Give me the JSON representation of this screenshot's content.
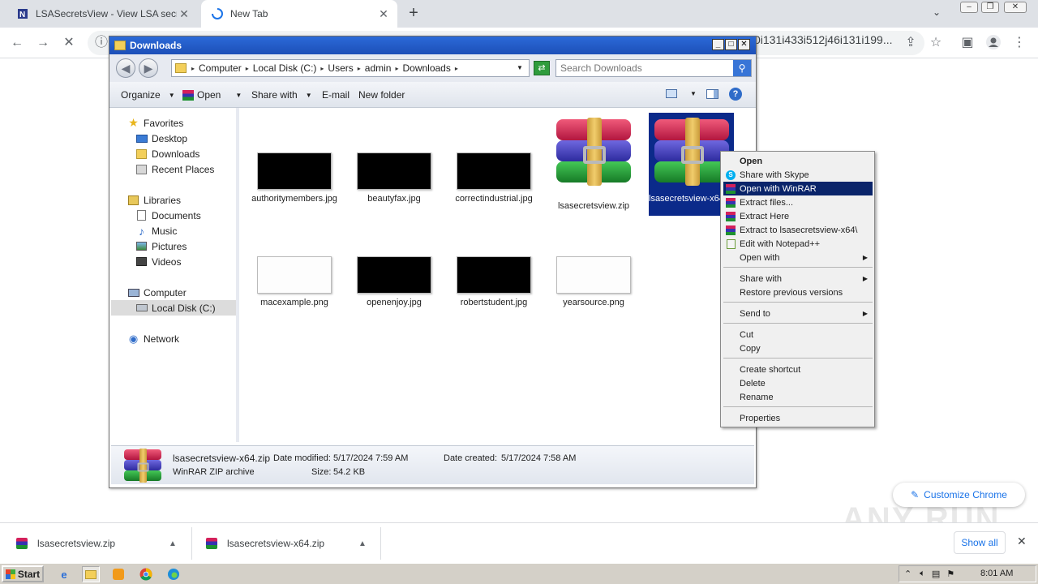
{
  "browser": {
    "tabs": [
      {
        "title": "LSASecretsView - View LSA secrets s",
        "favicon": "nirsoft-icon"
      },
      {
        "title": "New Tab",
        "favicon": "loading-spinner-icon"
      }
    ],
    "url_tail": "0i131i433i512j46i131i199..."
  },
  "explorer": {
    "window_title": "Downloads",
    "breadcrumb": [
      "Computer",
      "Local Disk (C:)",
      "Users",
      "admin",
      "Downloads"
    ],
    "search_placeholder": "Search Downloads",
    "commands": {
      "organize": "Organize",
      "open": "Open",
      "share_with": "Share with",
      "email": "E-mail",
      "new_folder": "New folder"
    },
    "nav": {
      "favorites": "Favorites",
      "desktop": "Desktop",
      "downloads": "Downloads",
      "recent_places": "Recent Places",
      "libraries": "Libraries",
      "documents": "Documents",
      "music": "Music",
      "pictures": "Pictures",
      "videos": "Videos",
      "computer": "Computer",
      "local_disk": "Local Disk (C:)",
      "network": "Network"
    },
    "files": [
      {
        "name": "authoritymembers.jpg",
        "thumb": "dark"
      },
      {
        "name": "beautyfax.jpg",
        "thumb": "dark"
      },
      {
        "name": "correctindustrial.jpg",
        "thumb": "dark"
      },
      {
        "name": "lsasecretsview.zip",
        "thumb": "winrar"
      },
      {
        "name": "lsasecretsview-x64.zip",
        "thumb": "winrar"
      },
      {
        "name": "macexample.png",
        "thumb": "light"
      },
      {
        "name": "openenjoy.jpg",
        "thumb": "dark"
      },
      {
        "name": "robertstudent.jpg",
        "thumb": "dark"
      },
      {
        "name": "yearsource.png",
        "thumb": "light"
      }
    ],
    "details": {
      "filename": "lsasecretsview-x64.zip",
      "type": "WinRAR ZIP archive",
      "date_modified_label": "Date modified:",
      "date_modified": "5/17/2024 7:59 AM",
      "date_created_label": "Date created:",
      "date_created": "5/17/2024 7:58 AM",
      "size_label": "Size:",
      "size": "54.2 KB"
    }
  },
  "context_menu": {
    "open": "Open",
    "share_skype": "Share with Skype",
    "open_winrar": "Open with WinRAR",
    "extract_files": "Extract files...",
    "extract_here": "Extract Here",
    "extract_to": "Extract to lsasecretsview-x64\\",
    "edit_notepad": "Edit with Notepad++",
    "open_with": "Open with",
    "share_with": "Share with",
    "restore": "Restore previous versions",
    "send_to": "Send to",
    "cut": "Cut",
    "copy": "Copy",
    "create_shortcut": "Create shortcut",
    "delete": "Delete",
    "rename": "Rename",
    "properties": "Properties"
  },
  "customize_chrome": "Customize Chrome",
  "watermark": "ANY RUN",
  "downloads_shelf": {
    "items": [
      "lsasecretsview.zip",
      "lsasecretsview-x64.zip"
    ],
    "show_all": "Show all"
  },
  "taskbar": {
    "start": "Start",
    "clock": "8:01 AM"
  }
}
